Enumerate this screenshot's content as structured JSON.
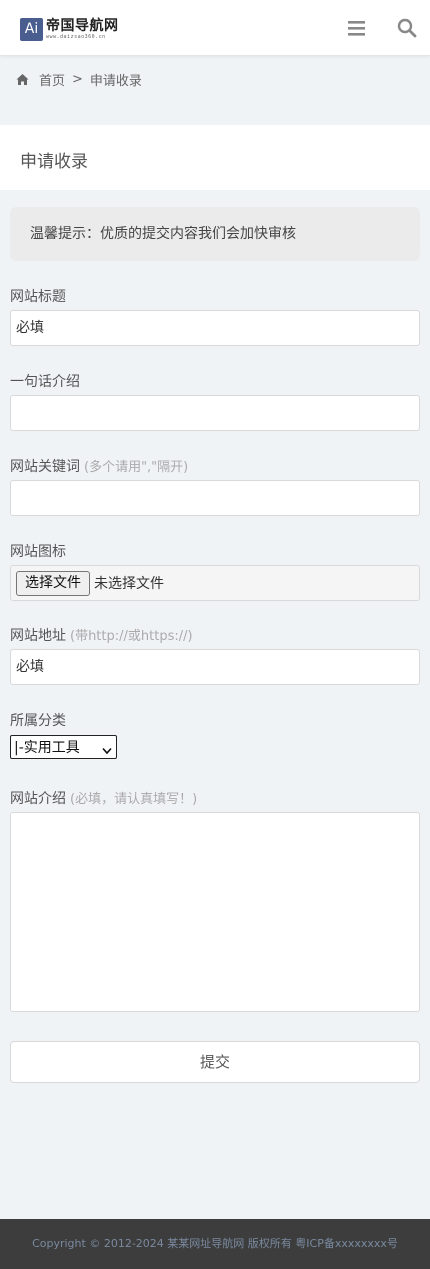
{
  "header": {
    "logo_mark": "Ai",
    "logo_name": "帝国导航网",
    "logo_domain": "www.daizsao360.cn",
    "menu_icon": "menu-icon",
    "search_icon": "search-icon"
  },
  "breadcrumb": {
    "home_icon": "home-icon",
    "home": "首页",
    "separator": ">",
    "current": "申请收录"
  },
  "page": {
    "title": "申请收录",
    "tip": "温馨提示：优质的提交内容我们会加快审核"
  },
  "form": {
    "site_title": {
      "label": "网站标题",
      "placeholder": "必填"
    },
    "slogan": {
      "label": "一句话介绍",
      "placeholder": ""
    },
    "keywords": {
      "label": "网站关键词",
      "hint": "(多个请用\",\"隔开)",
      "placeholder": ""
    },
    "icon": {
      "label": "网站图标",
      "button": "选择文件",
      "status": "未选择文件"
    },
    "url": {
      "label": "网站地址",
      "hint": "(带http://或https://)",
      "placeholder": "必填"
    },
    "category": {
      "label": "所属分类",
      "selected": "|-实用工具"
    },
    "description": {
      "label": "网站介绍",
      "hint": "(必填，请认真填写！)"
    },
    "submit": "提交"
  },
  "footer": {
    "text": "Copyright © 2012-2024 某某网址导航网 版权所有 粤ICP备xxxxxxxx号"
  }
}
